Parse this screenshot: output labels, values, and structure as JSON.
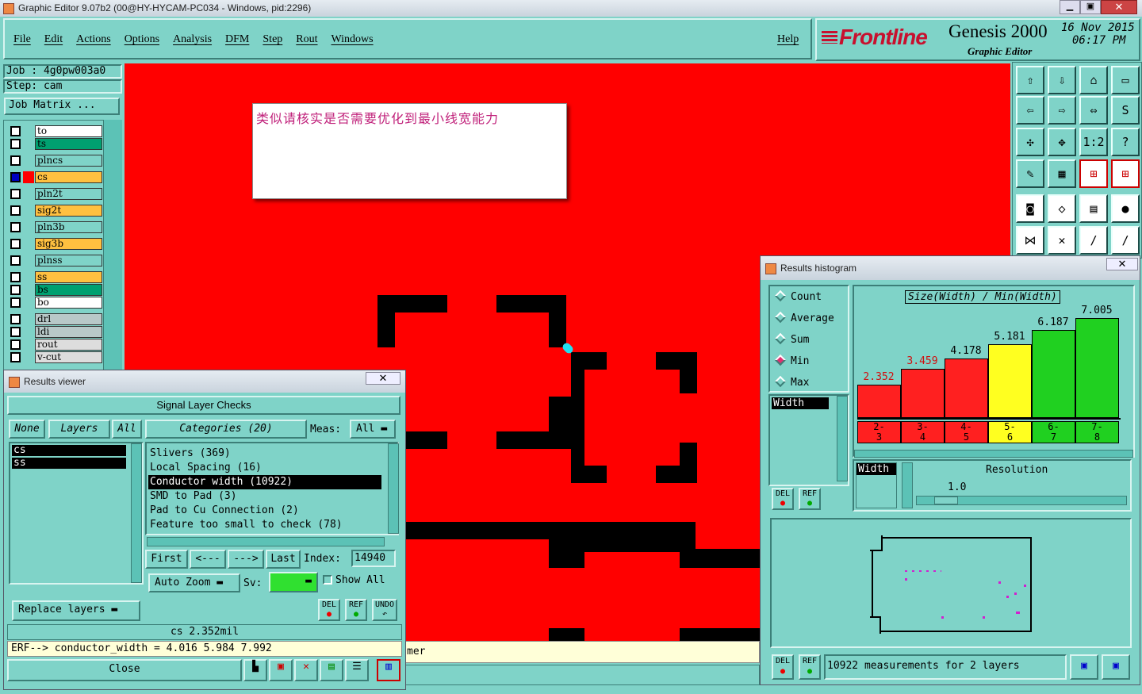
{
  "window_title": "Graphic Editor 9.07b2 (00@HY-HYCAM-PC034 - Windows, pid:2296)",
  "menu": [
    "File",
    "Edit",
    "Actions",
    "Options",
    "Analysis",
    "DFM",
    "Step",
    "Rout",
    "Windows"
  ],
  "help_label": "Help",
  "brand": {
    "logo": "Frontline",
    "product": "Genesis 2000",
    "subtitle": "Graphic Editor",
    "date": "16 Nov 2015",
    "time": "06:17 PM"
  },
  "job": {
    "job_line": "Job : 4g0pw003a0",
    "step_line": "Step: cam",
    "matrix_button": "Job Matrix ..."
  },
  "layers": [
    {
      "name": "to",
      "color": "#ffffff"
    },
    {
      "name": "ts",
      "color": "#00a070"
    },
    {
      "name": "plncs",
      "color": "#7fd3c8"
    },
    {
      "name": "cs",
      "color": "#ffc040"
    },
    {
      "name": "pln2t",
      "color": "#7fd3c8"
    },
    {
      "name": "sig2t",
      "color": "#ffc040"
    },
    {
      "name": "pln3b",
      "color": "#7fd3c8"
    },
    {
      "name": "sig3b",
      "color": "#ffc040"
    },
    {
      "name": "plnss",
      "color": "#7fd3c8"
    },
    {
      "name": "ss",
      "color": "#ffc040"
    },
    {
      "name": "bs",
      "color": "#00a070"
    },
    {
      "name": "bo",
      "color": "#ffffff"
    },
    {
      "name": "drl",
      "color": "#b8c8c8"
    },
    {
      "name": "ldi",
      "color": "#b8c8c8"
    },
    {
      "name": "rout",
      "color": "#dddddd"
    },
    {
      "name": "v-cut",
      "color": "#dddddd"
    }
  ],
  "note_text": "类似请核实是否需要优化到最小线宽能力",
  "canvas_status_fragment": "mer",
  "results_viewer": {
    "title": "Results viewer",
    "header": "Signal Layer Checks",
    "none_btn": "None",
    "layers_btn": "Layers",
    "all_btn": "All",
    "layer_list": [
      "cs",
      "ss"
    ],
    "categories_label": "Categories (20)",
    "meas_label": "Meas:",
    "meas_value": "All",
    "categories": [
      "Slivers (369)",
      "Local Spacing (16)",
      "Conductor width (10922)",
      "SMD to Pad (3)",
      "Pad to Cu Connection (2)",
      "Feature too small to check (78)"
    ],
    "selected_category": 2,
    "first_btn": "First",
    "prev_btn": "<---",
    "next_btn": "--->",
    "last_btn": "Last",
    "index_label": "Index:",
    "index_value": "14940",
    "zoom_select": "Auto Zoom",
    "sv_label": "Sv:",
    "show_all_label": "Show All",
    "replace_layers": "Replace layers",
    "del_label": "DEL",
    "ref_label": "REF",
    "undo_label": "UNDO",
    "measure_line": "cs 2.352mil",
    "erf_line": "ERF--> conductor_width = 4.016 5.984 7.992",
    "close_btn": "Close"
  },
  "histogram": {
    "title": "Results histogram",
    "modes": [
      "Count",
      "Average",
      "Sum",
      "Min",
      "Max"
    ],
    "selected_mode": "Min",
    "attr_list": [
      "Width"
    ],
    "chart_title": "Size(Width) / Min(Width)",
    "resolution_label": "Resolution",
    "resolution_value": "1.0",
    "width_label": "Width",
    "footer": "10922 measurements for 2 layers",
    "del_label": "DEL",
    "ref_label": "REF"
  },
  "chart_data": {
    "type": "bar",
    "title": "Size(Width) / Min(Width)",
    "categories": [
      "2-3",
      "3-4",
      "4-5",
      "5-6",
      "6-7",
      "7-8"
    ],
    "values": [
      2.352,
      3.459,
      4.178,
      5.181,
      6.187,
      7.005
    ],
    "bar_colors": [
      "#ff2020",
      "#ff2020",
      "#ff2020",
      "#ffff20",
      "#20d020",
      "#20d020"
    ],
    "label_colors": [
      "#d01010",
      "#d01010",
      "#000000",
      "#000000",
      "#000000",
      "#000000"
    ],
    "ylim": [
      0,
      7.8
    ]
  },
  "colors": {
    "canvas": "#ff0000",
    "panel": "#7fd3c8",
    "feature": "#000000",
    "note_text": "#c0207a"
  }
}
